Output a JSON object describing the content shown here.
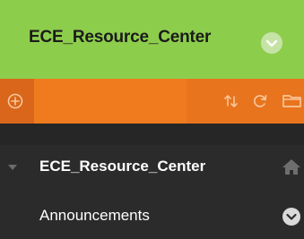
{
  "header": {
    "course_title": "ECE_Resource_Center",
    "menu_icon": "chevron-down-icon",
    "background": "#8dcd4c"
  },
  "toolbar": {
    "background": "#e8741e",
    "icons": [
      "add-icon",
      "sort-icon",
      "refresh-icon",
      "folder-icon"
    ]
  },
  "nav": {
    "course_item": {
      "label": "ECE_Resource_Center",
      "expand_icon": "caret-down-icon",
      "action_icon": "home-icon"
    },
    "items": [
      {
        "label": "Announcements",
        "menu_icon": "chevron-down-icon"
      }
    ]
  }
}
